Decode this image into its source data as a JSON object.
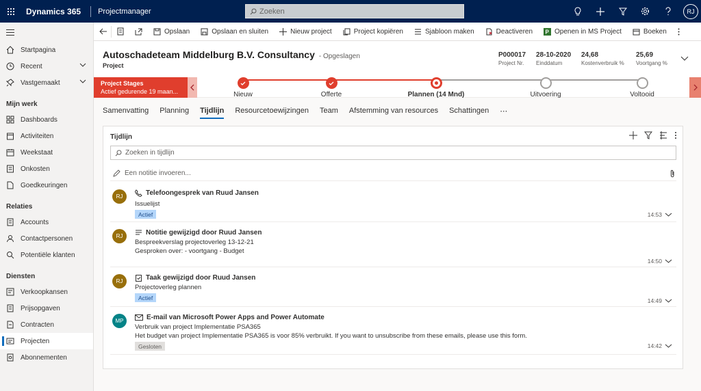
{
  "topbar": {
    "brand": "Dynamics 365",
    "app": "Projectmanager",
    "search_placeholder": "Zoeken",
    "user_initials": "RJ"
  },
  "sidebar": {
    "items_top": [
      {
        "label": "Startpagina",
        "icon": "home-icon"
      },
      {
        "label": "Recent",
        "icon": "clock-icon"
      },
      {
        "label": "Vastgemaakt",
        "icon": "pin-icon"
      }
    ],
    "groups": [
      {
        "title": "Mijn werk",
        "items": [
          "Dashboards",
          "Activiteiten",
          "Weekstaat",
          "Onkosten",
          "Goedkeuringen"
        ]
      },
      {
        "title": "Relaties",
        "items": [
          "Accounts",
          "Contactpersonen",
          "Potentiële klanten"
        ]
      },
      {
        "title": "Diensten",
        "items": [
          "Verkoopkansen",
          "Prijsopgaven",
          "Contracten",
          "Projecten",
          "Abonnementen"
        ]
      }
    ],
    "active_item": "Projecten"
  },
  "commandbar": {
    "commands": [
      {
        "label": "Opslaan",
        "icon": "save-icon"
      },
      {
        "label": "Opslaan en sluiten",
        "icon": "save-close-icon"
      },
      {
        "label": "Nieuw project",
        "icon": "plus-icon"
      },
      {
        "label": "Project kopiëren",
        "icon": "copy-icon"
      },
      {
        "label": "Sjabloon maken",
        "icon": "template-icon"
      },
      {
        "label": "Deactiveren",
        "icon": "deactivate-icon"
      },
      {
        "label": "Openen in MS Project",
        "icon": "ms-project-icon"
      },
      {
        "label": "Boeken",
        "icon": "book-icon"
      }
    ]
  },
  "header": {
    "title": "Autoschadeteam Middelburg B.V. Consultancy",
    "saved": "- Opgeslagen",
    "entity": "Project",
    "fields": [
      {
        "value": "P000017",
        "label": "Project Nr."
      },
      {
        "value": "28-10-2020",
        "label": "Einddatum"
      },
      {
        "value": "24,68",
        "label": "Kostenverbruik %"
      },
      {
        "value": "25,69",
        "label": "Voortgang %"
      }
    ]
  },
  "bpf": {
    "title": "Project Stages",
    "subtitle": "Actief gedurende 19 maan...",
    "stages": [
      {
        "label": "Nieuw",
        "state": "done"
      },
      {
        "label": "Offerte",
        "state": "done"
      },
      {
        "label": "Plannen  (14 Mnd)",
        "state": "current"
      },
      {
        "label": "Uitvoering",
        "state": "todo"
      },
      {
        "label": "Voltooid",
        "state": "todo"
      }
    ],
    "colors": {
      "active": "#e03e2d",
      "inactive": "#a19f9d"
    }
  },
  "tabs": [
    "Samenvatting",
    "Planning",
    "Tijdlijn",
    "Resourcetoewijzingen",
    "Team",
    "Afstemming van resources",
    "Schattingen",
    "⋯"
  ],
  "active_tab": "Tijdlijn",
  "timeline": {
    "title": "Tijdlijn",
    "search_placeholder": "Zoeken in tijdlijn",
    "note_placeholder": "Een notitie invoeren...",
    "entries": [
      {
        "initials": "RJ",
        "avatar_color": "#986f0b",
        "icon": "phone-icon",
        "title": "Telefoongesprek van Ruud Jansen",
        "lines": [
          "Issuelijst"
        ],
        "badge": "Actief",
        "badge_style": "blue",
        "time": "14:53"
      },
      {
        "initials": "RJ",
        "avatar_color": "#986f0b",
        "icon": "note-icon",
        "title": "Notitie gewijzigd door Ruud Jansen",
        "lines": [
          "Bespreekverslag projectoverleg 13-12-21",
          "Gesproken over: - voortgang - Budget"
        ],
        "badge": "",
        "badge_style": "",
        "time": "14:50"
      },
      {
        "initials": "RJ",
        "avatar_color": "#986f0b",
        "icon": "task-icon",
        "title": "Taak gewijzigd door Ruud Jansen",
        "lines": [
          "Projectoverleg plannen"
        ],
        "badge": "Actief",
        "badge_style": "blue",
        "time": "14:49"
      },
      {
        "initials": "MP",
        "avatar_color": "#038387",
        "icon": "email-icon",
        "title": "E-mail van Microsoft Power Apps and Power Automate",
        "lines": [
          "Verbruik van project Implementatie PSA365",
          "Het budget van project Implementatie PSA365 is voor 85% verbruikt. If you want to unsubscribe from these emails, please use this form."
        ],
        "badge": "Gesloten",
        "badge_style": "grey",
        "time": "14:42"
      }
    ]
  }
}
